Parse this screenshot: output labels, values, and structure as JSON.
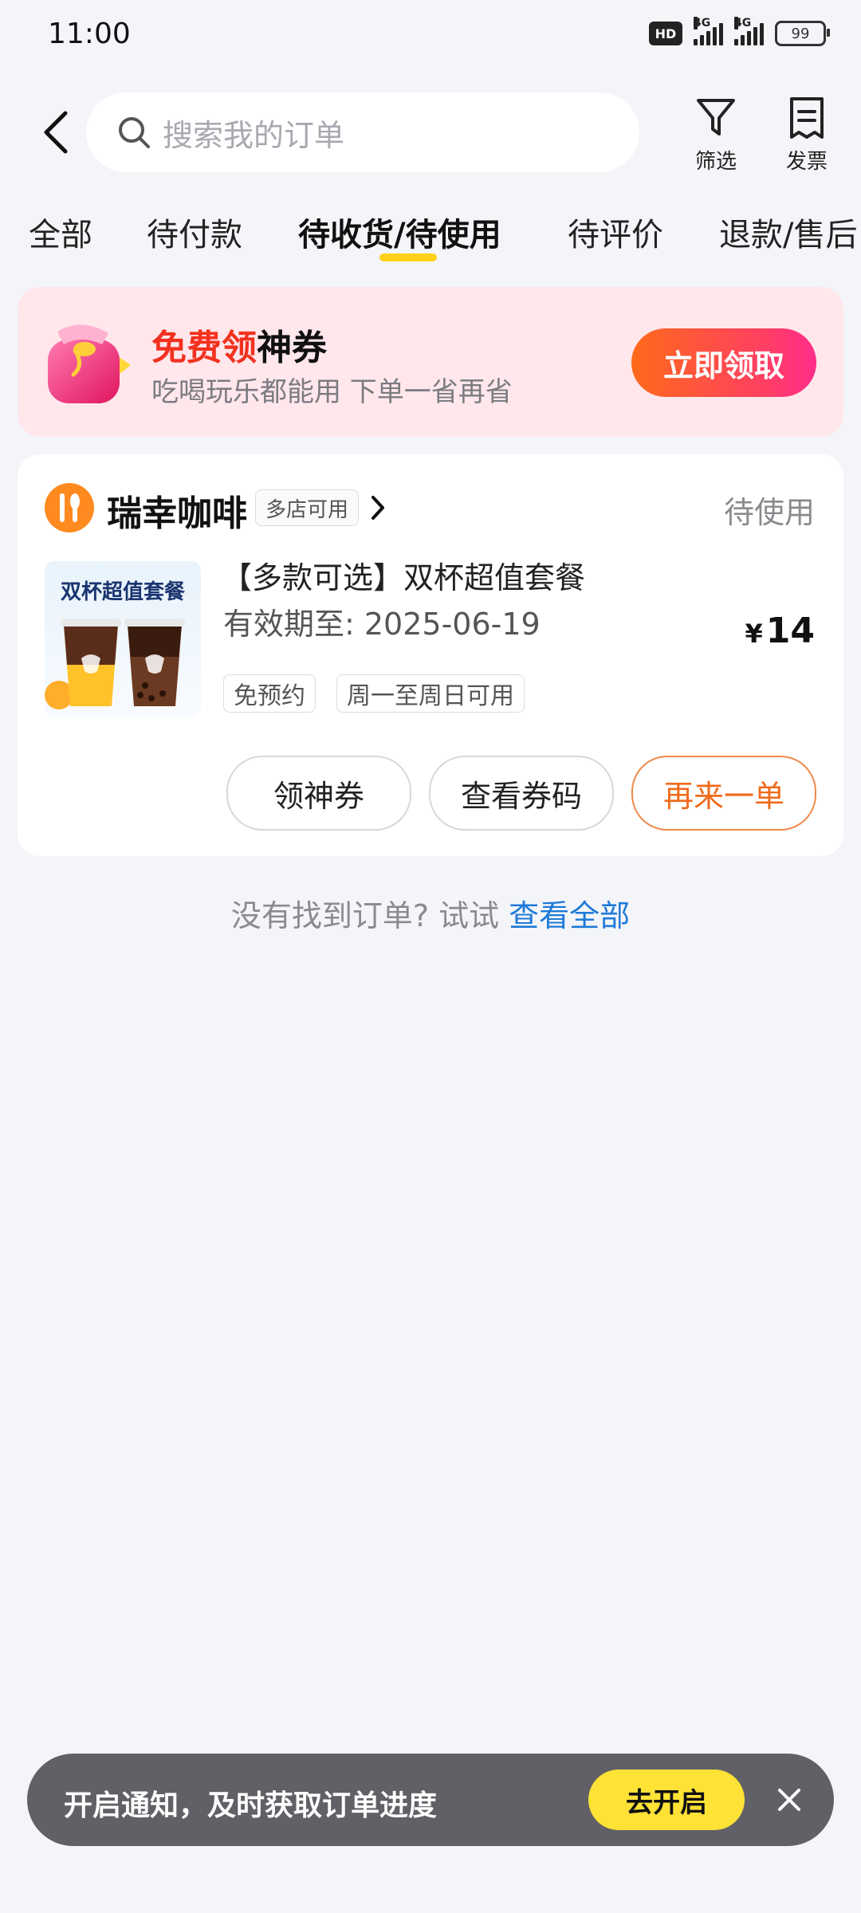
{
  "status_bar": {
    "time": "11:00",
    "hd_badge": "HD",
    "network_1": "4G",
    "network_2": "4G",
    "battery": "99"
  },
  "header": {
    "search_placeholder": "搜索我的订单",
    "filter_label": "筛选",
    "invoice_label": "发票"
  },
  "tabs": [
    {
      "label": "全部",
      "active": false
    },
    {
      "label": "待付款",
      "active": false
    },
    {
      "label": "待收货/待使用",
      "active": true
    },
    {
      "label": "待评价",
      "active": false
    },
    {
      "label": "退款/售后",
      "active": false
    }
  ],
  "promo": {
    "title_highlight": "免费领",
    "title_rest": "神券",
    "subtitle": "吃喝玩乐都能用 下单一省再省",
    "button": "立即领取"
  },
  "order": {
    "store_name": "瑞幸咖啡",
    "store_tag": "多店可用",
    "status": "待使用",
    "thumb_title": "双杯超值套餐",
    "product_name": "【多款可选】双杯超值套餐",
    "valid_until": "有效期至: 2025-06-19",
    "currency": "¥",
    "price": "14",
    "tags": [
      "免预约",
      "周一至周日可用"
    ],
    "actions": [
      "领神券",
      "查看券码",
      "再来一单"
    ]
  },
  "empty_hint": {
    "text": "没有找到订单? 试试 ",
    "link": "查看全部"
  },
  "toast": {
    "text": "开启通知，及时获取订单进度",
    "button": "去开启"
  },
  "colors": {
    "background": "#f4f5f9",
    "tab_underline": "#ffd01a",
    "promo_bg": "#ffe7ec",
    "promo_highlight": "#f2321f",
    "primary_orange": "#f06a1a",
    "link_blue": "#1f7ad8",
    "toast_bg": "#606066",
    "toast_button": "#ffe236"
  },
  "icons": {
    "back": "chevron-left-icon",
    "search": "search-icon",
    "filter": "funnel-icon",
    "invoice": "receipt-icon",
    "store": "fork-spoon-icon",
    "close": "close-icon"
  }
}
